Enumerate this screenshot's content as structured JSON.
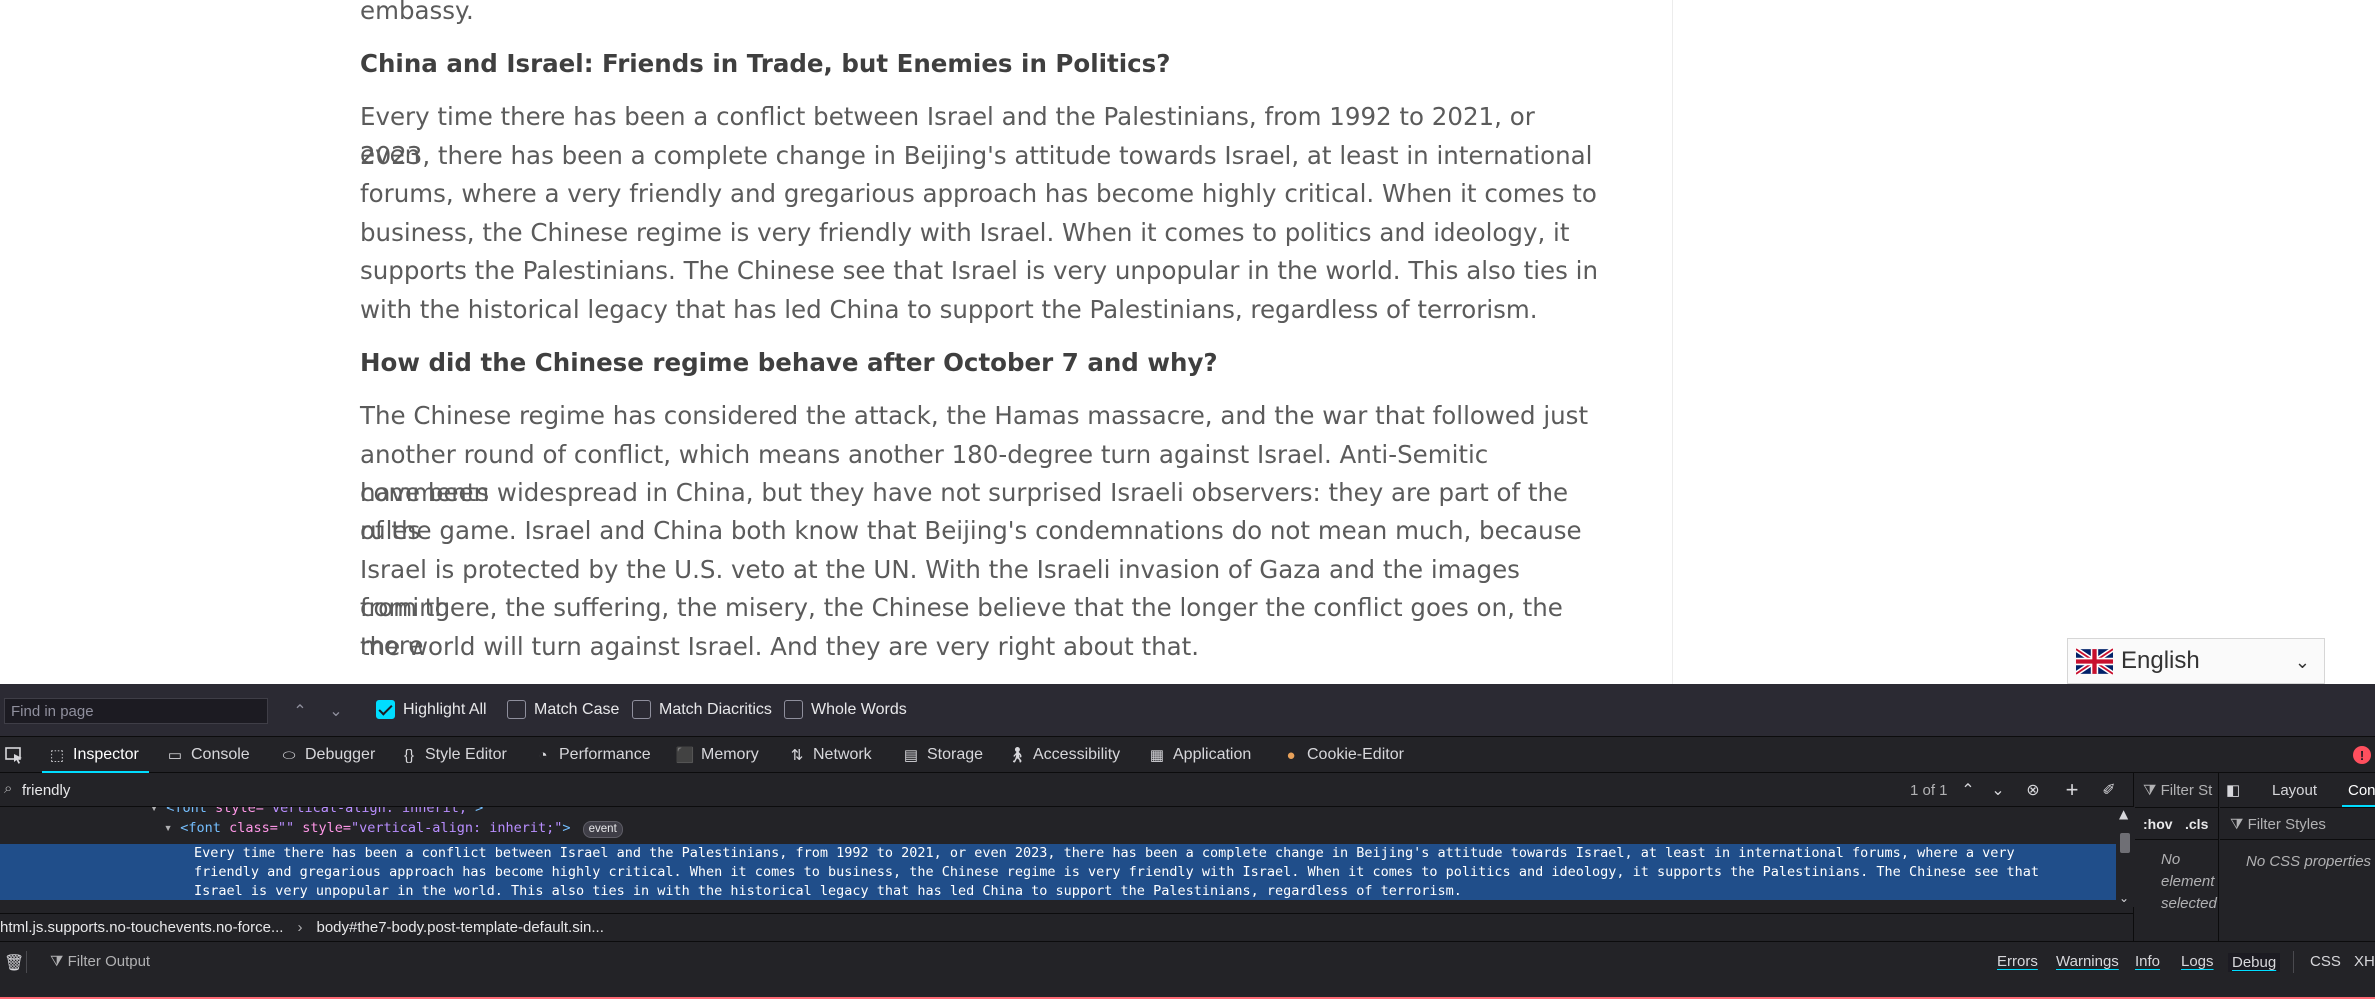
{
  "article": {
    "top_line": "embassy.",
    "heading1": "China and Israel: Friends in Trade, but Enemies in Politics?",
    "para1_lines": [
      "Every time there has been a conflict between Israel and the Palestinians, from 1992 to 2021, or even",
      "2023, there has been a complete change in Beijing's attitude towards Israel, at least in international",
      "forums, where a very friendly and gregarious approach has become highly critical. When it comes to",
      "business, the Chinese regime is very friendly with Israel. When it comes to politics and ideology, it",
      "supports the Palestinians. The Chinese see that Israel is very unpopular in the world. This also ties in",
      "with the historical legacy that has led China to support the Palestinians, regardless of terrorism."
    ],
    "heading2": "How did the Chinese regime behave after October 7 and why?",
    "para2_lines": [
      "The Chinese regime has considered the attack, the Hamas massacre, and the war that followed just",
      "another round of conflict, which means another 180-degree turn against Israel. Anti-Semitic comments",
      "have been widespread in China, but they have not surprised Israeli observers: they are part of the rules",
      "of the game. Israel and China both know that Beijing's condemnations do not mean much, because",
      "Israel is protected by the U.S. veto at the UN. With the Israeli invasion of Gaza and the images coming",
      "from there, the suffering, the misery, the Chinese believe that the longer the conflict goes on, the more",
      "the world will turn against Israel. And they are very right about that."
    ]
  },
  "language_selector": {
    "label": "English",
    "flag_icon": "uk-flag-icon"
  },
  "find_bar": {
    "placeholder": "Find in page",
    "value": "",
    "highlight_all": "Highlight All",
    "highlight_all_checked": true,
    "match_case": "Match Case",
    "match_diacritics": "Match Diacritics",
    "whole_words": "Whole Words"
  },
  "devtools": {
    "tabs": [
      "Inspector",
      "Console",
      "Debugger",
      "Style Editor",
      "Performance",
      "Memory",
      "Network",
      "Storage",
      "Accessibility",
      "Application",
      "Cookie-Editor"
    ],
    "active_tab": "Inspector",
    "error_badge": "!"
  },
  "inspector": {
    "search_value": "friendly",
    "search_count": "1 of 1",
    "tree": {
      "line0_tag": "<font",
      "line0_attr": "style=",
      "line0_val": "\"vertical-align: inherit;\"",
      "line0_close": ">",
      "line1_open": "<font",
      "line1_class_attr": "class=",
      "line1_class_val": "\"\"",
      "line1_style_attr": "style=",
      "line1_style_val": "\"vertical-align: inherit;\"",
      "line1_close": ">",
      "event_badge": "event",
      "selected_text": "Every time there has been a conflict between Israel and the Palestinians, from 1992 to 2021, or even 2023, there has been a complete change in Beijing's attitude towards Israel, at least in international forums, where a very friendly and gregarious approach has become highly critical. When it comes to business, the Chinese regime is very friendly with Israel. When it comes to politics and ideology, it supports the Palestinians. The Chinese see that Israel is very unpopular in the world. This also ties in with the historical legacy that has led China to support the Palestinians, regardless of terrorism."
    },
    "breadcrumbs": [
      "html.js.supports.no-touchevents.no-force...",
      "body#the7-body.post-template-default.sin..."
    ],
    "rules": {
      "filter_placeholder": "Filter St",
      "hov": ":hov",
      "cls": ".cls",
      "empty_lines": [
        "No",
        "element",
        "selected"
      ]
    },
    "layout": {
      "tab_layout": "Layout",
      "tab_computed": "Con",
      "filter_placeholder": "Filter Styles",
      "empty": "No CSS properties"
    }
  },
  "console": {
    "filter_placeholder": "Filter Output",
    "buttons": [
      "Errors",
      "Warnings",
      "Info",
      "Logs",
      "Debug"
    ],
    "css": "CSS",
    "xhr": "XH"
  }
}
